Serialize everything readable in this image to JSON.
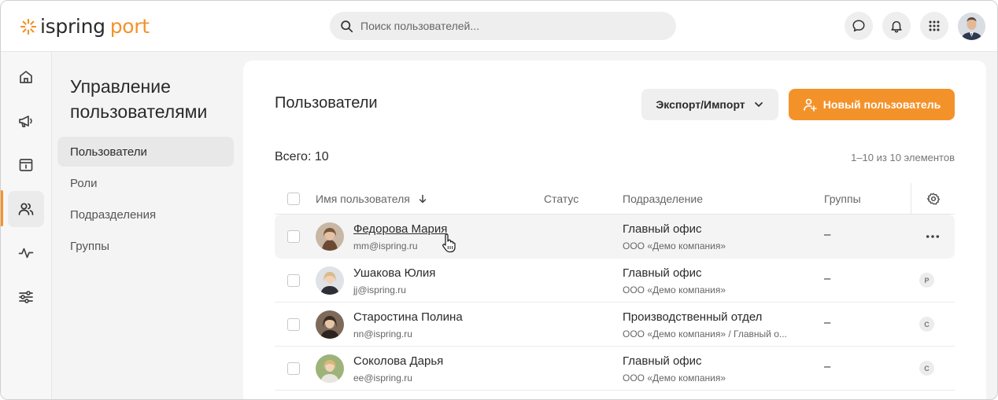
{
  "header": {
    "logo_word1": "ispring",
    "logo_word2": "port",
    "search_placeholder": "Поиск пользователей...",
    "icons": [
      "chat-icon",
      "bell-icon",
      "apps-grid-icon"
    ]
  },
  "rail": {
    "items": [
      "home-icon",
      "megaphone-icon",
      "calendar-info-icon",
      "users-icon",
      "activity-icon",
      "sliders-icon"
    ],
    "active": "users-icon"
  },
  "sidebar": {
    "title": "Управление пользователями",
    "items": [
      {
        "label": "Пользователи",
        "active": true
      },
      {
        "label": "Роли",
        "active": false
      },
      {
        "label": "Подразделения",
        "active": false
      },
      {
        "label": "Группы",
        "active": false
      }
    ]
  },
  "main": {
    "title": "Пользователи",
    "export_label": "Экспорт/Импорт",
    "new_user_label": "Новый пользователь",
    "total_label": "Всего: 10",
    "range_label": "1–10 из 10 элементов",
    "columns": {
      "name": "Имя пользователя",
      "status": "Статус",
      "department": "Подразделение",
      "groups": "Группы"
    },
    "rows": [
      {
        "name": "Федорова Мария",
        "email": "mm@ispring.ru",
        "department": "Главный офис",
        "org": "ООО «Демо компания»",
        "groups": "–",
        "badge": ""
      },
      {
        "name": "Ушакова Юлия",
        "email": "jj@ispring.ru",
        "department": "Главный офис",
        "org": "ООО «Демо компания»",
        "groups": "–",
        "badge": "Р"
      },
      {
        "name": "Старостина Полина",
        "email": "nn@ispring.ru",
        "department": "Производственный отдел",
        "org": "ООО «Демо компания» / Главный о...",
        "groups": "–",
        "badge": "С"
      },
      {
        "name": "Соколова Дарья",
        "email": "ee@ispring.ru",
        "department": "Главный офис",
        "org": "ООО «Демо компания»",
        "groups": "–",
        "badge": "С"
      }
    ]
  },
  "colors": {
    "accent": "#f4922a",
    "background": "#f4f4f4",
    "card": "#ffffff"
  }
}
